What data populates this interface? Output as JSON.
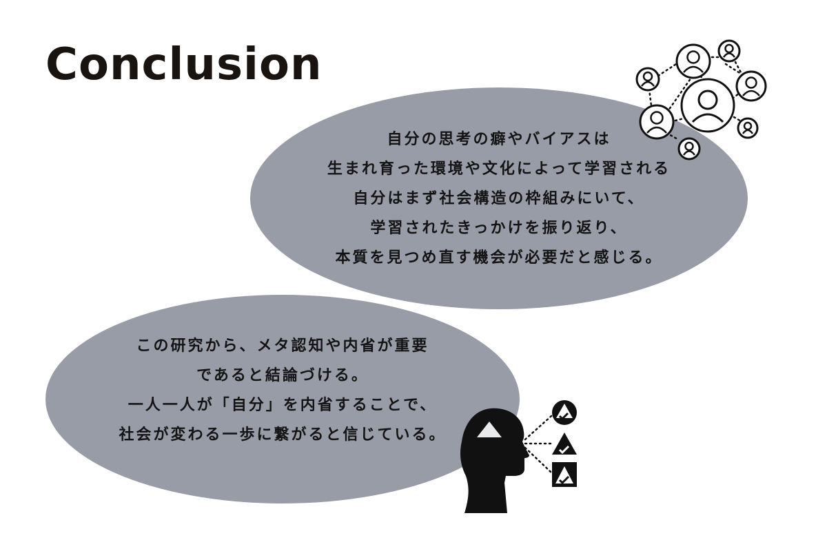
{
  "title": "Conclusion",
  "colors": {
    "bubble": "#989ca7",
    "ink": "#141414"
  },
  "bubble_top": {
    "lines": [
      "自分の思考の癖やバイアスは",
      "生まれ育った環境や文化によって学習される",
      "自分はまず社会構造の枠組みにいて、",
      "学習されたきっかけを振り返り、",
      "本質を見つめ直す機会が必要だと感じる。"
    ]
  },
  "bubble_bottom": {
    "lines": [
      "この研究から、メタ認知や内省が重要",
      "であると結論づける。",
      "一人一人が「自分」を内省することで、",
      "社会が変わる一歩に繋がると信じている。"
    ]
  },
  "icons": {
    "network": "people-network-icon",
    "head": "head-profile-icon",
    "checks": [
      "triangle-check-circle-icon",
      "triangle-check-icon",
      "triangle-check-square-icon"
    ]
  }
}
